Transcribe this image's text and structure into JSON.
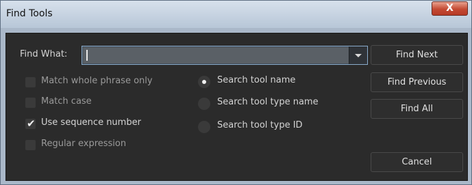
{
  "window": {
    "title": "Find Tools",
    "close_glyph": "X"
  },
  "find_what": {
    "label": "Find What:",
    "value": ""
  },
  "options": [
    {
      "label": "Match whole phrase only",
      "checked": false
    },
    {
      "label": "Match case",
      "checked": false
    },
    {
      "label": "Use sequence number",
      "checked": true
    },
    {
      "label": "Regular expression",
      "checked": false
    }
  ],
  "search_modes": [
    {
      "label": "Search tool name",
      "selected": true
    },
    {
      "label": "Search tool type name",
      "selected": false
    },
    {
      "label": "Search tool type ID",
      "selected": false
    }
  ],
  "buttons": {
    "find_next": "Find Next",
    "find_previous": "Find Previous",
    "find_all": "Find All",
    "cancel": "Cancel"
  },
  "colors": {
    "client_bg": "#2b2b2b",
    "title_bar": "#c8d4e2",
    "close_button": "#c44a33",
    "field_border": "#8aaccc"
  }
}
